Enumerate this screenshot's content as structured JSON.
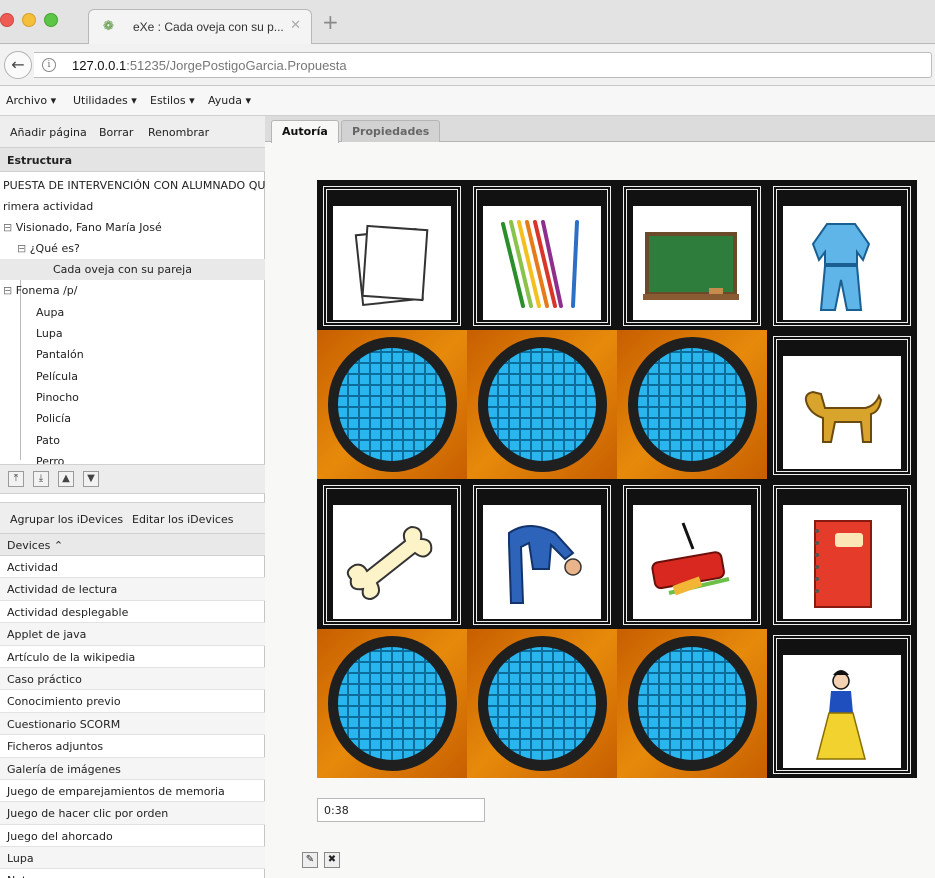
{
  "browser": {
    "tab_title": "eXe : Cada oveja con su p...",
    "tab_close": "✕",
    "new_tab": "+",
    "url_host": "127.0.0.1",
    "url_rest": ":51235/JorgePostigoGarcia.Propuesta"
  },
  "menu": [
    "Archivo ▾",
    "Utilidades ▾",
    "Estilos ▾",
    "Ayuda ▾"
  ],
  "outline_toolbar": [
    "Añadir página",
    "Borrar",
    "Renombrar"
  ],
  "structure": {
    "title": "Estructura",
    "items": [
      {
        "label": "PUESTA DE INTERVENCIÓN CON ALUMNADO QU",
        "prefix": ""
      },
      {
        "label": "rimera actividad",
        "prefix": ""
      },
      {
        "label": "Visionado, Fano María José",
        "prefix": "⊟"
      },
      {
        "label": "¿Qué es?",
        "prefix": "⊟"
      },
      {
        "label": "Cada oveja con su pareja",
        "prefix": ""
      },
      {
        "label": "Fonema /p/",
        "prefix": "⊟"
      },
      {
        "label": "Aupa",
        "prefix": ""
      },
      {
        "label": "Lupa",
        "prefix": ""
      },
      {
        "label": "Pantalón",
        "prefix": ""
      },
      {
        "label": "Película",
        "prefix": ""
      },
      {
        "label": "Pinocho",
        "prefix": ""
      },
      {
        "label": "Policía",
        "prefix": ""
      },
      {
        "label": "Pato",
        "prefix": ""
      },
      {
        "label": "Perro",
        "prefix": ""
      }
    ]
  },
  "tree_buttons": [
    "⤒",
    "⤓",
    "▲",
    "▼"
  ],
  "idevices_toolbar": [
    "Agrupar los iDevices",
    "Editar los iDevices"
  ],
  "idevices": {
    "header": "Devices ⌃",
    "items": [
      "Actividad",
      "Actividad de lectura",
      "Actividad desplegable",
      "Applet de java",
      "Artículo de la wikipedia",
      "Caso práctico",
      "Conocimiento previo",
      "Cuestionario SCORM",
      "Ficheros adjuntos",
      "Galería de imágenes",
      "Juego de emparejamientos de memoria",
      "Juego de hacer clic por orden",
      "Juego del ahorcado",
      "Lupa",
      "Nota"
    ]
  },
  "main_tabs": [
    "Autoría",
    "Propiedades"
  ],
  "game": {
    "cards": [
      {
        "state": "front",
        "icon": "papers-icon"
      },
      {
        "state": "front",
        "icon": "colored-pencils-icon"
      },
      {
        "state": "front",
        "icon": "chalkboard-icon"
      },
      {
        "state": "front",
        "icon": "tracksuit-icon"
      },
      {
        "state": "back",
        "icon": "card-back-icon"
      },
      {
        "state": "back",
        "icon": "card-back-icon"
      },
      {
        "state": "back",
        "icon": "card-back-icon"
      },
      {
        "state": "front",
        "icon": "dog-icon"
      },
      {
        "state": "front",
        "icon": "bone-icon"
      },
      {
        "state": "front",
        "icon": "person-bending-icon"
      },
      {
        "state": "front",
        "icon": "pencil-case-icon"
      },
      {
        "state": "front",
        "icon": "notebook-icon"
      },
      {
        "state": "back",
        "icon": "card-back-icon"
      },
      {
        "state": "back",
        "icon": "card-back-icon"
      },
      {
        "state": "back",
        "icon": "card-back-icon"
      },
      {
        "state": "front",
        "icon": "princess-icon"
      }
    ],
    "timer": "0:38"
  },
  "colors": {
    "card_back_orange": "#e78a0b",
    "card_back_blue": "#29b6ef",
    "card_frame": "#111111"
  }
}
